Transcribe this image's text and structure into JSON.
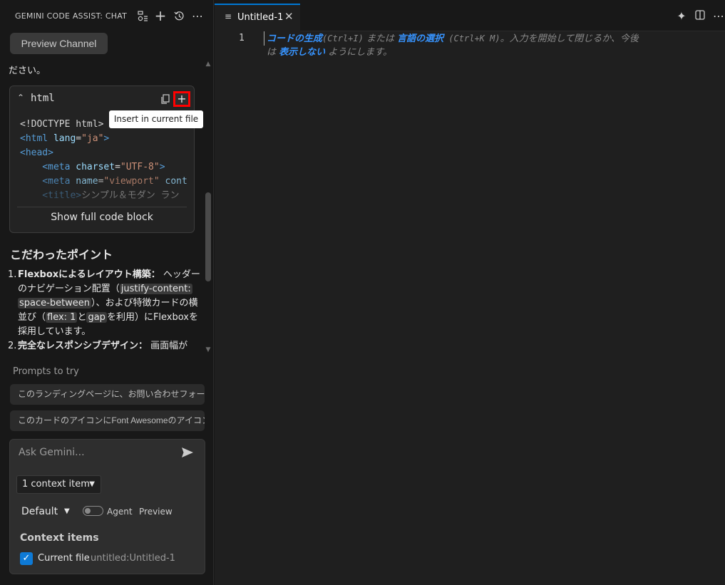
{
  "sidebar": {
    "title": "GEMINI CODE ASSIST: CHAT",
    "preview_channel": "Preview Channel",
    "cut_text": "ださい。",
    "code_block": {
      "language": "html",
      "insert_tooltip": "Insert in current file",
      "show_full": "Show full code block",
      "lines": [
        [
          {
            "t": "<!DOCTYPE html>",
            "c": "c-plain"
          }
        ],
        [
          {
            "t": "<html ",
            "c": "c-tag"
          },
          {
            "t": "lang",
            "c": "c-attr"
          },
          {
            "t": "=",
            "c": "c-plain"
          },
          {
            "t": "\"ja\"",
            "c": "c-str"
          },
          {
            "t": ">",
            "c": "c-tag"
          }
        ],
        [
          {
            "t": "<head>",
            "c": "c-tag"
          }
        ],
        [
          {
            "t": "    <meta ",
            "c": "c-tag"
          },
          {
            "t": "charset",
            "c": "c-attr"
          },
          {
            "t": "=",
            "c": "c-plain"
          },
          {
            "t": "\"UTF-8\"",
            "c": "c-str"
          },
          {
            "t": ">",
            "c": "c-tag"
          }
        ],
        [
          {
            "t": "    <meta ",
            "c": "c-tag"
          },
          {
            "t": "name",
            "c": "c-attr"
          },
          {
            "t": "=",
            "c": "c-plain"
          },
          {
            "t": "\"viewport\"",
            "c": "c-str"
          },
          {
            "t": " cont",
            "c": "c-attr"
          }
        ],
        [
          {
            "t": "    <title>",
            "c": "c-tag"
          },
          {
            "t": "シンプル＆モダン ラン",
            "c": "c-plain"
          }
        ]
      ]
    },
    "section_title": "こだわったポイント",
    "points": [
      {
        "num": "1.",
        "lines": [
          "Flexboxによるレイアウト構築： ヘッダー",
          "のナビゲーション配置（justify-content:",
          "space-between）、および特徴カードの横",
          "並び（flex: 1とgapを利用）にFlexboxを",
          "採用しています。"
        ]
      },
      {
        "num": "2.",
        "lines": [
          "完全なレスポンシブデザイン： 画面幅が"
        ]
      }
    ],
    "prompts_label": "Prompts to try",
    "prompts": [
      "このランディングページに、お問い合わせフォームを追加して",
      "このカードのアイコンにFont Awesomeのアイコンを使って"
    ],
    "input": {
      "placeholder": "Ask Gemini...",
      "context_dropdown": "1 context item",
      "model": "Default",
      "agent_label": "Agent",
      "preview_label": "Preview",
      "context_title": "Context items",
      "context_file_label": "Current file",
      "context_file_name": "untitled:Untitled-1"
    }
  },
  "editor": {
    "tab_label": "Untitled-1",
    "line_number": "1",
    "hint": {
      "link1": "コードの生成",
      "kb1": "(Ctrl+I)",
      "mid1": " または ",
      "link2": "言語の選択",
      "kb2": " (Ctrl+K M)",
      "mid2": "。入力を開始して閉じるか、今後",
      "row2_pre": "は ",
      "link3": "表示しない",
      "row2_post": " ようにします。"
    }
  }
}
